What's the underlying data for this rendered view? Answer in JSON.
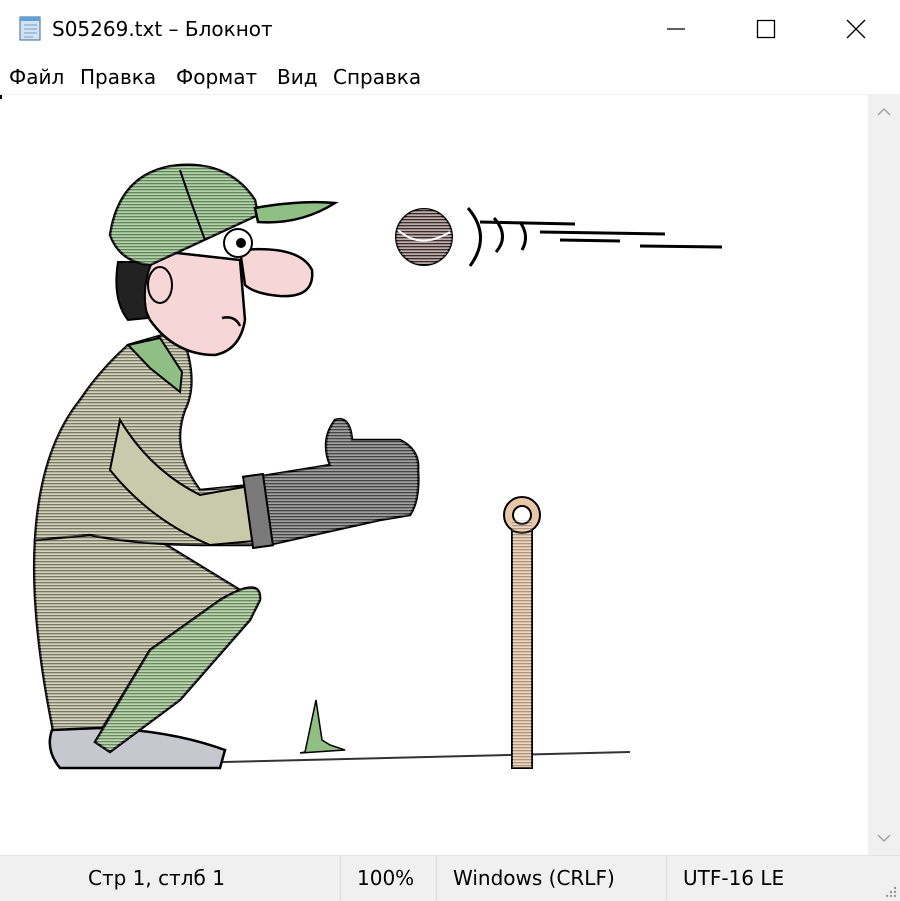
{
  "window": {
    "title": "S05269.txt – Блокнот",
    "icon": "notepad-icon",
    "controls": {
      "minimize": "minimize-icon",
      "maximize": "maximize-icon",
      "close": "close-icon"
    }
  },
  "menu": {
    "items": [
      {
        "label": "Файл"
      },
      {
        "label": "Правка"
      },
      {
        "label": "Формат"
      },
      {
        "label": "Вид"
      },
      {
        "label": "Справка"
      }
    ]
  },
  "editor": {
    "content": "ascii-art-cricket-wicketkeeper",
    "picture_colors": {
      "cap": "#8fbf85",
      "shirt": "#b9b99a",
      "glove": "#6b6b6b",
      "pad": "#9bc48c",
      "skin": "#f6d6d6",
      "stump": "#e8c7a8",
      "ball": "#7a5a5a"
    }
  },
  "statusbar": {
    "position": "Стр 1, стлб 1",
    "zoom": "100%",
    "line_ending": "Windows (CRLF)",
    "encoding": "UTF-16 LE"
  }
}
